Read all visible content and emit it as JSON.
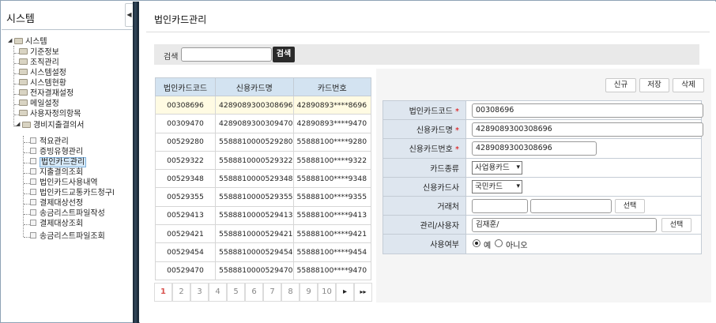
{
  "sidebar": {
    "title": "시스템",
    "collapse_icon": "◀",
    "tree": [
      {
        "label": "시스템",
        "level": 0,
        "type": "folder",
        "expanded": true
      },
      {
        "label": "기준정보",
        "level": 1,
        "type": "folder"
      },
      {
        "label": "조직관리",
        "level": 1,
        "type": "folder"
      },
      {
        "label": "시스템설정",
        "level": 1,
        "type": "folder"
      },
      {
        "label": "시스템현황",
        "level": 1,
        "type": "folder"
      },
      {
        "label": "전자결재설정",
        "level": 1,
        "type": "folder"
      },
      {
        "label": "메일설정",
        "level": 1,
        "type": "folder"
      },
      {
        "label": "사용자정의항목",
        "level": 1,
        "type": "folder"
      },
      {
        "label": "경비지출결의서",
        "level": 1,
        "type": "folder",
        "expanded": true
      },
      {
        "label": "적요관리",
        "level": 2,
        "type": "page"
      },
      {
        "label": "증빙유형관리",
        "level": 2,
        "type": "page"
      },
      {
        "label": "법인카드관리",
        "level": 2,
        "type": "page",
        "selected": true
      },
      {
        "label": "지출결의조회",
        "level": 2,
        "type": "page"
      },
      {
        "label": "법인카드사용내역",
        "level": 2,
        "type": "page"
      },
      {
        "label": "법인카드교통카드청구l",
        "level": 2,
        "type": "page"
      },
      {
        "label": "결제대상선정",
        "level": 2,
        "type": "page"
      },
      {
        "label": "송금리스트파일작성",
        "level": 2,
        "type": "page"
      },
      {
        "label": "결제대상조회",
        "level": 2,
        "type": "page"
      },
      {
        "label": "송금리스트파일조회",
        "level": 2,
        "type": "page"
      }
    ]
  },
  "main": {
    "title": "법인카드관리",
    "search": {
      "label": "검색",
      "value": "",
      "button": "검색"
    },
    "list": {
      "headers": [
        "법인카드코드",
        "신용카드명",
        "카드번호"
      ],
      "rows": [
        [
          "00308696",
          "4289089300308696",
          "42890893****8696"
        ],
        [
          "00309470",
          "4289089300309470",
          "42890893****9470"
        ],
        [
          "00529280",
          "5588810000529280",
          "55888100****9280"
        ],
        [
          "00529322",
          "5588810000529322",
          "55888100****9322"
        ],
        [
          "00529348",
          "5588810000529348",
          "55888100****9348"
        ],
        [
          "00529355",
          "5588810000529355",
          "55888100****9355"
        ],
        [
          "00529413",
          "5588810000529413",
          "55888100****9413"
        ],
        [
          "00529421",
          "5588810000529421",
          "55888100****9421"
        ],
        [
          "00529454",
          "5588810000529454",
          "55888100****9454"
        ],
        [
          "00529470",
          "5588810000529470",
          "55888100****9470"
        ]
      ],
      "selected_row": 0
    },
    "pager": {
      "pages": [
        "1",
        "2",
        "3",
        "4",
        "5",
        "6",
        "7",
        "8",
        "9",
        "10"
      ],
      "current": "1",
      "next_icon": "▸",
      "last_icon": "▸▸"
    },
    "actions": {
      "new": "신규",
      "save": "저장",
      "delete": "삭제"
    },
    "form": {
      "card_code": {
        "label": "법인카드코드",
        "required": "*",
        "value": "00308696"
      },
      "card_name": {
        "label": "신용카드명",
        "required": "*",
        "value": "4289089300308696"
      },
      "card_number": {
        "label": "신용카드번호",
        "required": "*",
        "value": "4289089300308696"
      },
      "card_type": {
        "label": "카드종류",
        "value": "사업용카드"
      },
      "card_company": {
        "label": "신용카드사",
        "value": "국민카드"
      },
      "vendor": {
        "label": "거래처",
        "value1": "",
        "value2": "",
        "button": "선택"
      },
      "manager": {
        "label": "관리/사용자",
        "value": "김재훈/",
        "button": "선택"
      },
      "usage": {
        "label": "사용여부",
        "yes": "예",
        "no": "아니오",
        "selected": "yes"
      }
    }
  }
}
